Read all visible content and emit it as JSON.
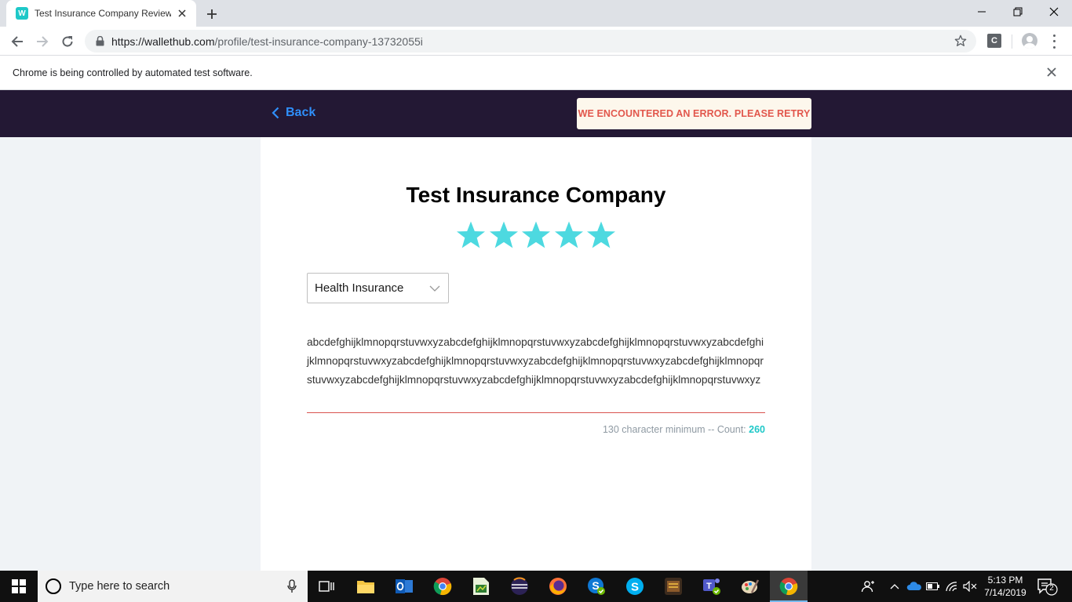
{
  "browser": {
    "tab_title": "Test Insurance Company Reviews",
    "favicon_letter": "W",
    "url_host": "https://wallethub.com",
    "url_path": "/profile/test-insurance-company-13732055i",
    "extension_letter": "C",
    "infobar_text": "Chrome is being controlled by automated test software."
  },
  "header": {
    "back_label": "Back",
    "error_message": "WE ENCOUNTERED AN ERROR. PLEASE RETRY"
  },
  "review": {
    "company_name": "Test Insurance Company",
    "rating": 5,
    "rating_max": 5,
    "star_color": "#4dd9e0",
    "category_selected": "Health Insurance",
    "text": "abcdefghijklmnopqrstuvwxyzabcdefghijklmnopqrstuvwxyzabcdefghijklmnopqrstuvwxyzabcdefghijklmnopqrstuvwxyzabcdefghijklmnopqrstuvwxyzabcdefghijklmnopqrstuvwxyzabcdefghijklmnopqrstuvwxyzabcdefghijklmnopqrstuvwxyzabcdefghijklmnopqrstuvwxyzabcdefghijklmnopqrstuvwxyz",
    "char_min_label": "130 character minimum -- Count: ",
    "char_count": "260"
  },
  "taskbar": {
    "search_placeholder": "Type here to search",
    "time": "5:13 PM",
    "date": "7/14/2019",
    "notification_count": "2",
    "apps": [
      "task-view-icon",
      "file-explorer-icon",
      "outlook-icon",
      "chrome-icon",
      "spreadsheet-icon",
      "eclipse-icon",
      "firefox-icon",
      "skype-business-icon",
      "skype-icon",
      "game-icon",
      "teams-icon",
      "paint-icon",
      "chrome-active-icon"
    ]
  },
  "colors": {
    "header_bg": "#231834",
    "accent": "#1ec8c8",
    "error_text": "#e2574c",
    "link": "#2f8ffa"
  }
}
